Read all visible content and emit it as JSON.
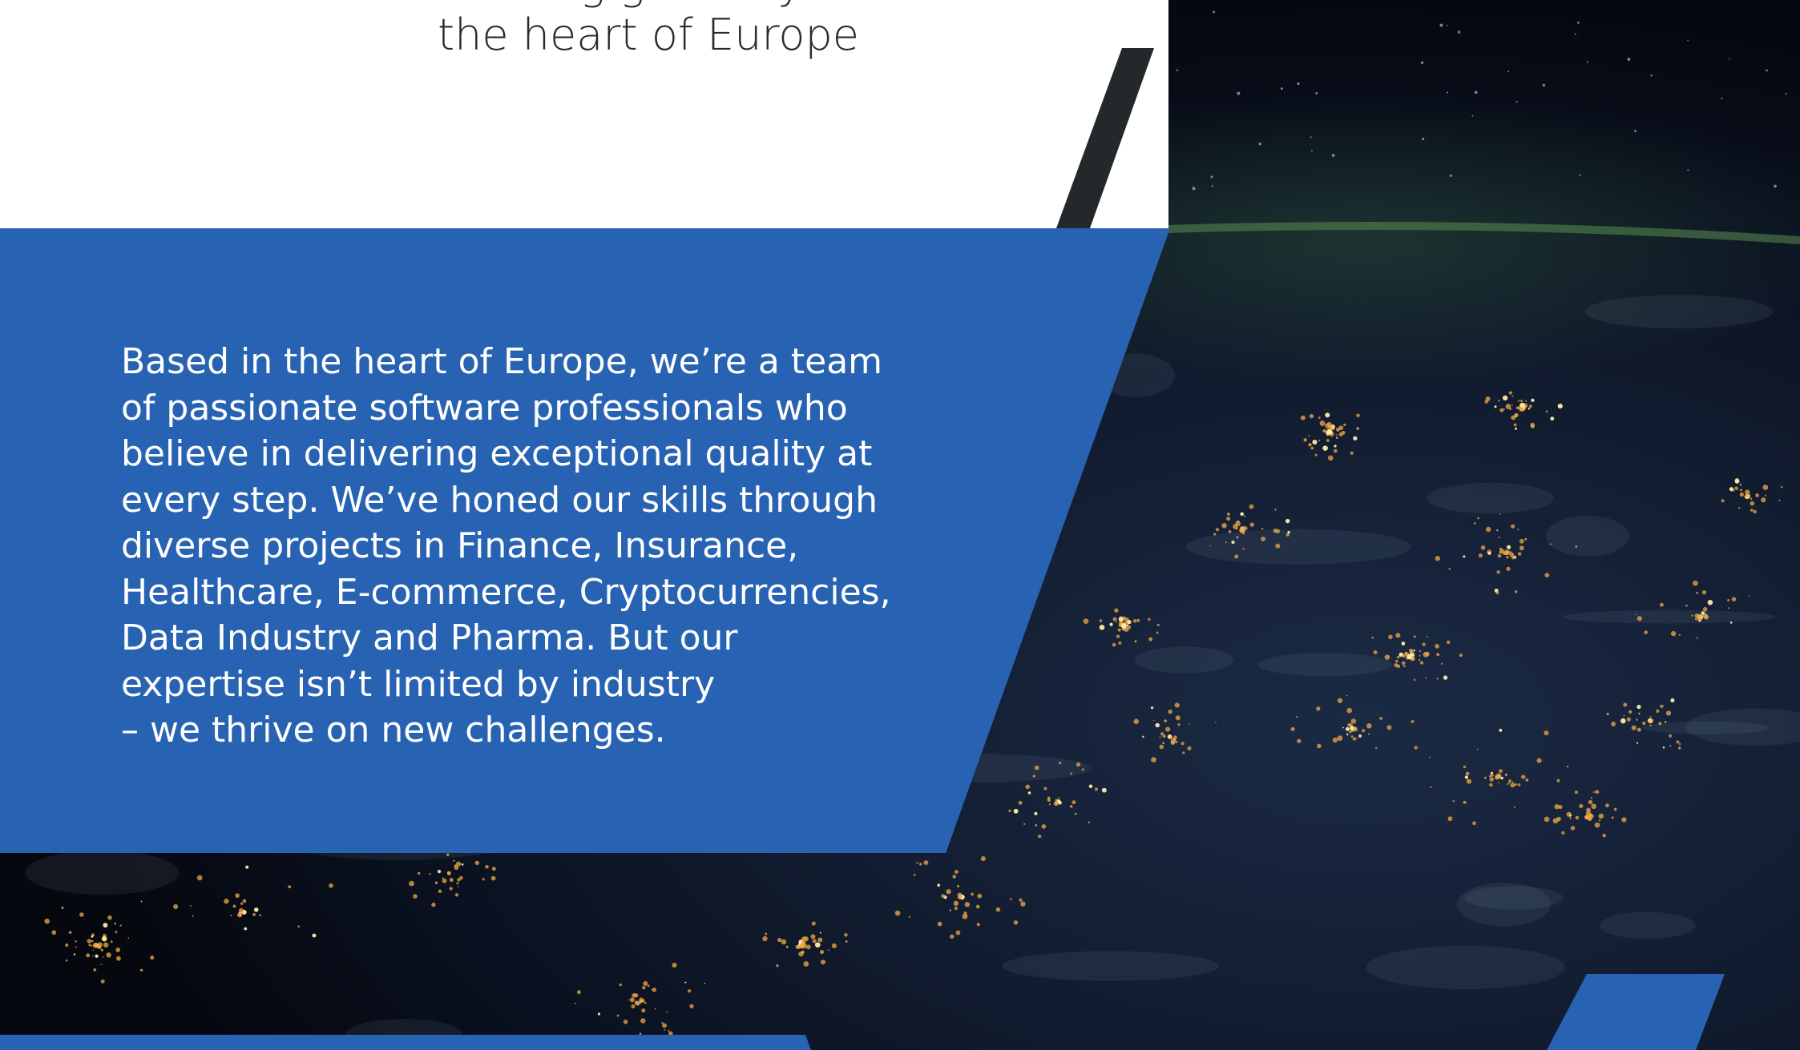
{
  "hero": {
    "heading_line1": "Leading gateway to",
    "heading_line2": "the heart of Europe"
  },
  "about": {
    "paragraph": "Based in the heart of Europe, we’re a team\nof passionate software professionals who\nbelieve in delivering exceptional quality at\nevery step. We’ve honed our skills through\ndiverse projects in Finance, Insurance,\nHealthcare, E-commerce, Cryptocurrencies,\nData Industry and Pharma. But our\nexpertise isn’t limited by industry\n– we thrive on new challenges."
  },
  "colors": {
    "brand_blue": "#2863b3",
    "heading_text": "#2a2a2a",
    "body_text": "#ffffff",
    "space_black": "#000000"
  },
  "images": {
    "background": "earth-at-night-image"
  }
}
